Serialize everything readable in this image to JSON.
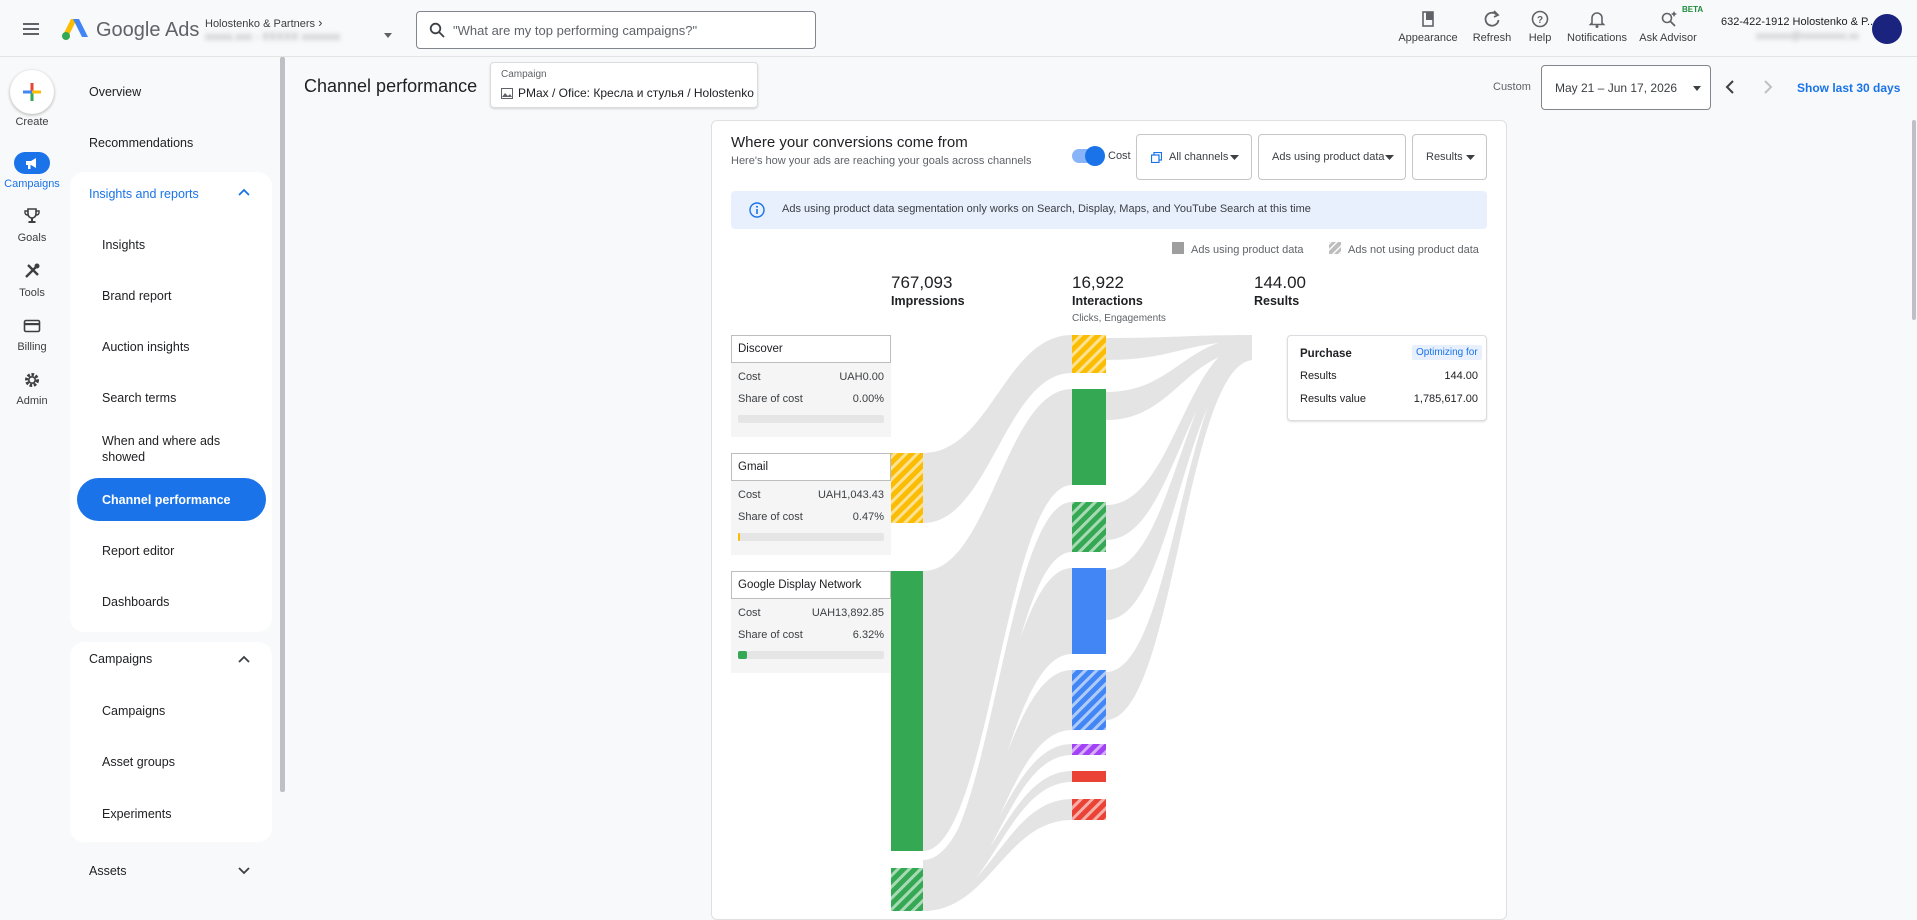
{
  "header": {
    "brand": "Google Ads",
    "account_name": "Holostenko & Partners",
    "account_sub": "xxxxx.xxx - XXXXX xxxxxxx",
    "search_placeholder": "\"What are my top performing campaigns?\"",
    "actions": [
      {
        "label": "Appearance",
        "icon": "appearance-icon"
      },
      {
        "label": "Refresh",
        "icon": "refresh-icon"
      },
      {
        "label": "Help",
        "icon": "help-icon"
      },
      {
        "label": "Notifications",
        "icon": "bell-icon"
      },
      {
        "label": "Ask Advisor",
        "icon": "sparkle-icon",
        "badge": "BETA"
      }
    ],
    "account_right": "632-422-1912 Holostenko & P...",
    "account_email": "xxxxxxx@xxxxxxxxx.xx"
  },
  "rail": {
    "create": "Create",
    "items": [
      {
        "label": "Campaigns",
        "icon": "megaphone-icon"
      },
      {
        "label": "Goals",
        "icon": "trophy-icon"
      },
      {
        "label": "Tools",
        "icon": "tools-icon"
      },
      {
        "label": "Billing",
        "icon": "card-icon"
      },
      {
        "label": "Admin",
        "icon": "gear-icon"
      }
    ]
  },
  "nav": {
    "overview": "Overview",
    "recommendations": "Recommendations",
    "insights_section": "Insights and reports",
    "insights_items": [
      "Insights",
      "Brand report",
      "Auction insights",
      "Search terms",
      "When and where ads showed",
      "Channel performance",
      "Report editor",
      "Dashboards"
    ],
    "campaigns_section": "Campaigns",
    "campaigns_items": [
      "Campaigns",
      "Asset groups",
      "Experiments"
    ],
    "assets_section": "Assets"
  },
  "page": {
    "title": "Channel performance",
    "campaign_label": "Campaign",
    "campaign_value": "PMax / Ofice: Кресла и стулья / Holostenko",
    "custom_label": "Custom",
    "date_range": "May 21 – Jun 17, 2026",
    "show_last": "Show last 30 days"
  },
  "card": {
    "title": "Where your conversions come from",
    "subtitle": "Here's how your ads are reaching your goals across channels",
    "cost_toggle": "Cost",
    "channels_btn": "All channels",
    "product_btn": "Ads using product data",
    "results_btn": "Results",
    "info": "Ads using product data segmentation only works on Search, Display, Maps, and YouTube Search at this time",
    "legend_using": "Ads using product data",
    "legend_not_using": "Ads not using product data",
    "metrics": [
      {
        "value": "767,093",
        "label": "Impressions",
        "sub": ""
      },
      {
        "value": "16,922",
        "label": "Interactions",
        "sub": "Clicks, Engagements"
      },
      {
        "value": "144.00",
        "label": "Results",
        "sub": ""
      }
    ],
    "cost_label": "Cost",
    "share_label": "Share of cost",
    "channels": [
      {
        "name": "Discover",
        "cost": "UAH0.00",
        "share": "0.00%",
        "share_value": 0.0,
        "color": "#fbbc04"
      },
      {
        "name": "Gmail",
        "cost": "UAH1,043.43",
        "share": "0.47%",
        "share_value": 0.47,
        "color": "#fbbc04"
      },
      {
        "name": "Google Display Network",
        "cost": "UAH13,892.85",
        "share": "6.32%",
        "share_value": 6.32,
        "color": "#34a853"
      }
    ],
    "purchase": {
      "name": "Purchase",
      "tag": "Optimizing for",
      "results_label": "Results",
      "results_value": "144.00",
      "value_label": "Results value",
      "value_value": "1,785,617.00"
    }
  },
  "colors": {
    "accent": "#1a73e8",
    "yellow": "#fbbc04",
    "green": "#34a853",
    "blue": "#4285f4",
    "purple": "#a142f4",
    "red": "#ea4335",
    "teal": "#12b5cb",
    "flow": "#e3e3e3"
  }
}
